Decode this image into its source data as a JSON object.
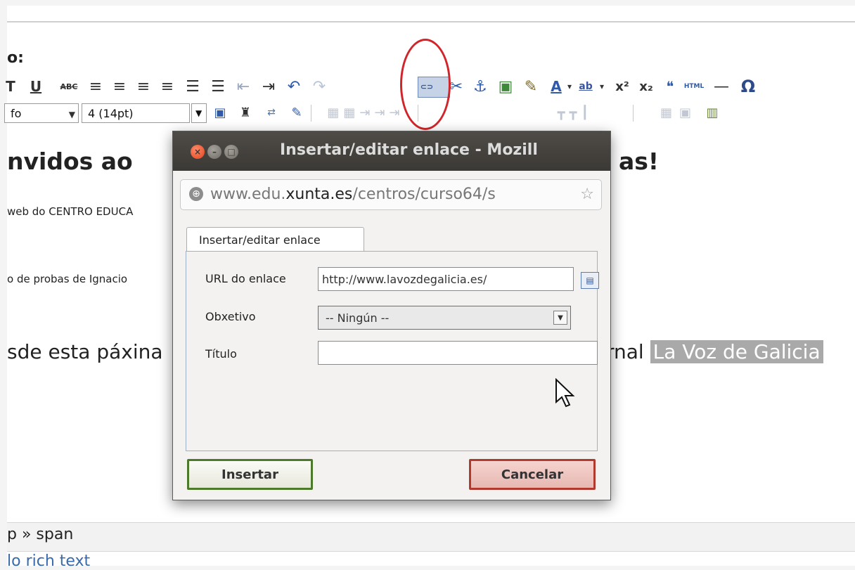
{
  "editor": {
    "field_label": "o:",
    "toolbar1": [
      "T",
      "U",
      "ABC",
      "≡",
      "≡",
      "≡",
      "≡",
      "☰",
      "☰",
      "⇤",
      "⇥",
      "↶",
      "↷",
      "⊂⊃",
      "✂",
      "⚓",
      "▣",
      "✎",
      "A",
      "▾",
      "ab",
      "▾",
      "x²",
      "x₂",
      "❝",
      "HTML",
      "—",
      "Ω"
    ],
    "toolbar2": {
      "font_select": "fo",
      "size_select": "4 (14pt)"
    },
    "heading_left": "nvidos ao",
    "heading_right": "as!",
    "line1": "web do CENTRO EDUCA",
    "line2": "o de probas de Ignacio",
    "big_line_left": "sde esta páxina",
    "big_line_right": "rnal",
    "selected_text": "La Voz de Galicia",
    "path": "p » span",
    "bottom_link": "lo rich text"
  },
  "dialog": {
    "title": "Insertar/editar enlace - Mozill",
    "url": {
      "prefix": "www.edu.",
      "domain": "xunta.es",
      "suffix": "/centros/curso64/s"
    },
    "tab_label": "Insertar/editar enlace",
    "fields": {
      "url_label": "URL do enlace",
      "url_value": "http://www.lavozdegalicia.es/",
      "target_label": "Obxetivo",
      "target_value": "-- Ningún --",
      "title_label": "Título",
      "title_value": ""
    },
    "buttons": {
      "insert": "Insertar",
      "cancel": "Cancelar"
    }
  },
  "colors": {
    "annotation_circle": "#d0262b",
    "insert_border": "#4c7a2a",
    "cancel_border": "#b03a2e"
  }
}
